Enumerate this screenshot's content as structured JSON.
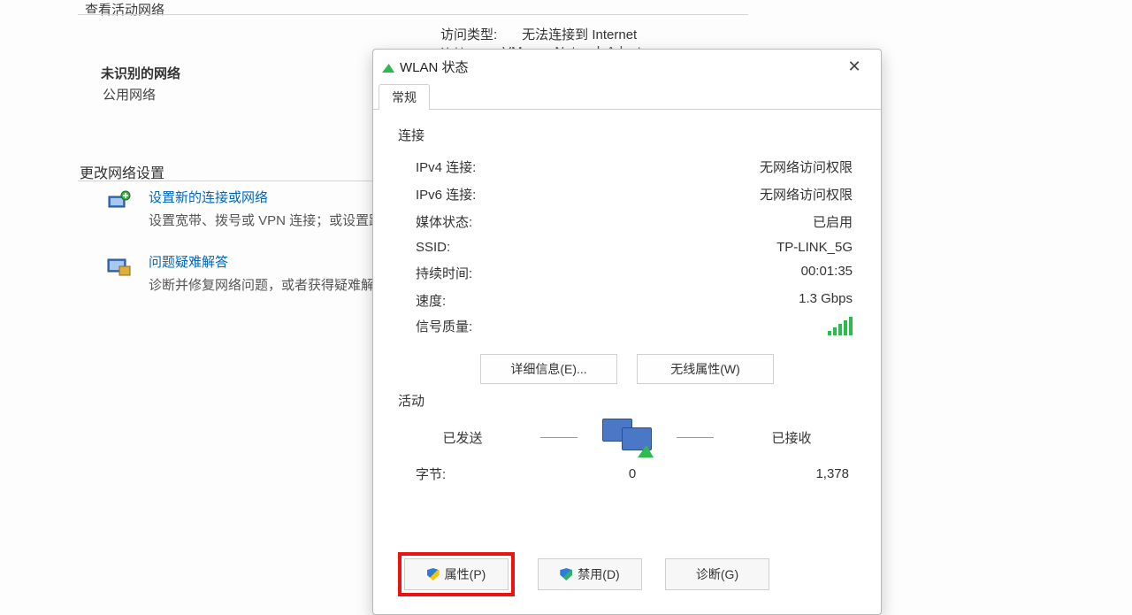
{
  "bg": {
    "view_active_networks": "查看活动网络",
    "unrecognized_network": "未识别的网络",
    "public_network": "公用网络",
    "access_type_label": "访问类型:",
    "access_type_value": "无法连接到 Internet",
    "connections_label": "连接:",
    "connections_value": "VMware Network Adapter",
    "change_settings": "更改网络设置",
    "setup_link": "设置新的连接或网络",
    "setup_desc": "设置宽带、拨号或 VPN 连接；或设置路由器或接入点。",
    "troubleshoot_link": "问题疑难解答",
    "troubleshoot_desc": "诊断并修复网络问题，或者获得疑难解答信息。"
  },
  "dialog": {
    "title": "WLAN 状态",
    "tab": "常规",
    "section_connection": "连接",
    "rows": {
      "ipv4_label": "IPv4 连接:",
      "ipv4_value": "无网络访问权限",
      "ipv6_label": "IPv6 连接:",
      "ipv6_value": "无网络访问权限",
      "media_label": "媒体状态:",
      "media_value": "已启用",
      "ssid_label": "SSID:",
      "ssid_value": "TP-LINK_5G",
      "duration_label": "持续时间:",
      "duration_value": "00:01:35",
      "speed_label": "速度:",
      "speed_value": "1.3 Gbps",
      "signal_label": "信号质量:"
    },
    "details_button": "详细信息(E)...",
    "wireless_props_button": "无线属性(W)",
    "section_activity": "活动",
    "sent_label": "已发送",
    "received_label": "已接收",
    "bytes_label": "字节:",
    "bytes_sent": "0",
    "bytes_received": "1,378",
    "props_button": "属性(P)",
    "disable_button": "禁用(D)",
    "diagnose_button": "诊断(G)"
  }
}
